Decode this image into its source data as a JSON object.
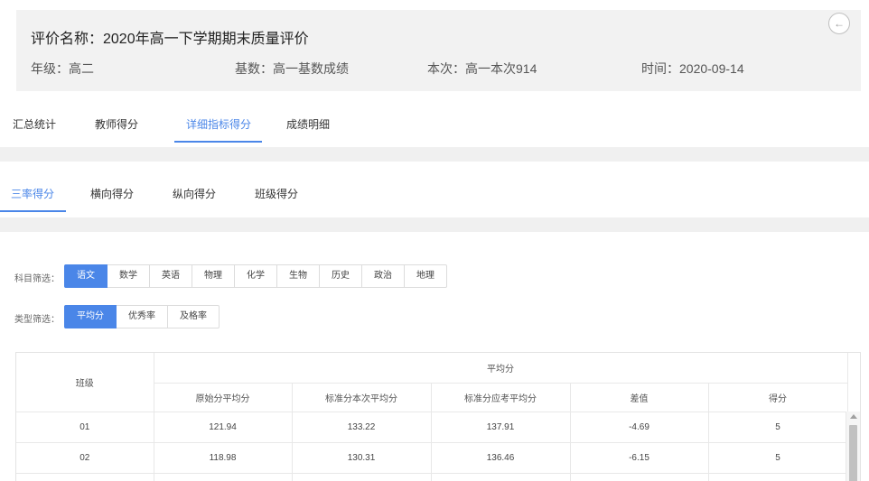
{
  "header": {
    "title": "评价名称：2020年高一下学期期末质量评价",
    "grade": "年级：高二",
    "base": "基数：高一基数成绩",
    "current": "本次：高一本次914",
    "time": "时间：2020-09-14",
    "back_icon": "←"
  },
  "main_tabs": [
    {
      "label": "汇总统计",
      "active": false
    },
    {
      "label": "教师得分",
      "active": false
    },
    {
      "label": "详细指标得分",
      "active": true
    },
    {
      "label": "成绩明细",
      "active": false
    }
  ],
  "sub_tabs": [
    {
      "label": "三率得分",
      "active": true
    },
    {
      "label": "横向得分",
      "active": false
    },
    {
      "label": "纵向得分",
      "active": false
    },
    {
      "label": "班级得分",
      "active": false
    }
  ],
  "filters": {
    "subject_label": "科目筛选：",
    "subjects": [
      "语文",
      "数学",
      "英语",
      "物理",
      "化学",
      "生物",
      "历史",
      "政治",
      "地理"
    ],
    "subject_selected": "语文",
    "type_label": "类型筛选：",
    "types": [
      "平均分",
      "优秀率",
      "及格率"
    ],
    "type_selected": "平均分"
  },
  "table": {
    "class_header": "班级",
    "group_header": "平均分",
    "columns": [
      "原始分平均分",
      "标准分本次平均分",
      "标准分应考平均分",
      "差值",
      "得分"
    ],
    "rows": [
      {
        "class": "01",
        "raw_avg": "121.94",
        "std_current_avg": "133.22",
        "std_expected_avg": "137.91",
        "diff": "-4.69",
        "score": "5"
      },
      {
        "class": "02",
        "raw_avg": "118.98",
        "std_current_avg": "130.31",
        "std_expected_avg": "136.46",
        "diff": "-6.15",
        "score": "5"
      }
    ]
  },
  "colors": {
    "accent": "#4a86e8",
    "panel_bg": "#f2f2f2",
    "band_bg": "#f0f0f0"
  }
}
